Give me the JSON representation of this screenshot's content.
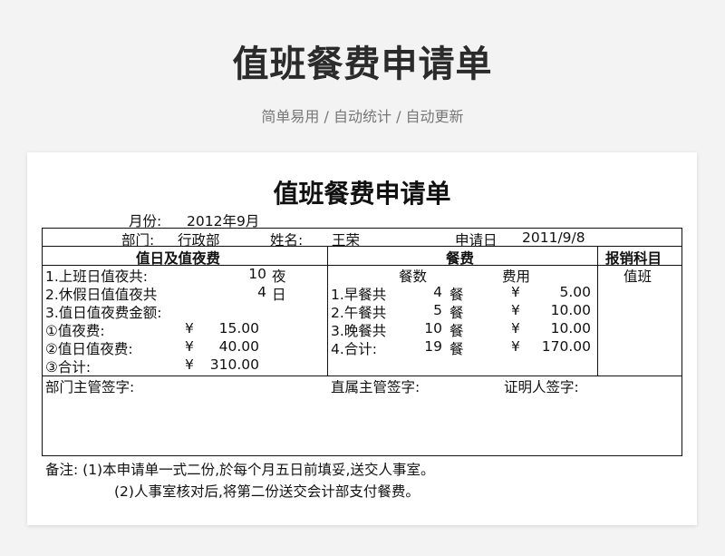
{
  "banner": {
    "title": "值班餐费申请单",
    "subtitle": "简单易用 / 自动统计 / 自动更新"
  },
  "form": {
    "title": "值班餐费申请单",
    "month_label": "月份:",
    "month_value": "2012年9月",
    "dept_label": "部门:",
    "dept_value": "行政部",
    "name_label": "姓名:",
    "name_value": "王荣",
    "apply_date_label": "申请日",
    "apply_date_value": "2011/9/8",
    "section_duty": "值日及值夜费",
    "section_meal": "餐费",
    "section_subject": "报销科目",
    "duty": {
      "row1_label": "1.上班日值夜共:",
      "row1_num": "10",
      "row1_unit": "夜",
      "row2_label": "2.休假日值值夜共",
      "row2_num": "4",
      "row2_unit": "日",
      "row3_label": "3.值日值夜费金额:",
      "fee_rows": [
        {
          "label": "①值夜费:",
          "currency": "¥",
          "amount": "15.00"
        },
        {
          "label": "②值日值夜费:",
          "currency": "¥",
          "amount": "40.00"
        },
        {
          "label": "③合计:",
          "currency": "¥",
          "amount": "310.00"
        }
      ]
    },
    "meal": {
      "col_count": "餐数",
      "col_fee": "费用",
      "rows": [
        {
          "label": "1.早餐共",
          "count": "4",
          "unit": "餐",
          "currency": "¥",
          "amount": "5.00"
        },
        {
          "label": "2.午餐共",
          "count": "5",
          "unit": "餐",
          "currency": "¥",
          "amount": "10.00"
        },
        {
          "label": "3.晚餐共",
          "count": "10",
          "unit": "餐",
          "currency": "¥",
          "amount": "10.00"
        },
        {
          "label": "4.合计:",
          "count": "19",
          "unit": "餐",
          "currency": "¥",
          "amount": "170.00"
        }
      ]
    },
    "subject_value": "值班",
    "sign_dept": "部门主管签字:",
    "sign_direct": "直属主管签字:",
    "sign_witness": "证明人签字:",
    "note1": "备注: (1)本申请单一式二份,於每个月五日前填妥,送交人事室。",
    "note2": "(2)人事室核对后,将第二份送交会计部支付餐费。"
  }
}
